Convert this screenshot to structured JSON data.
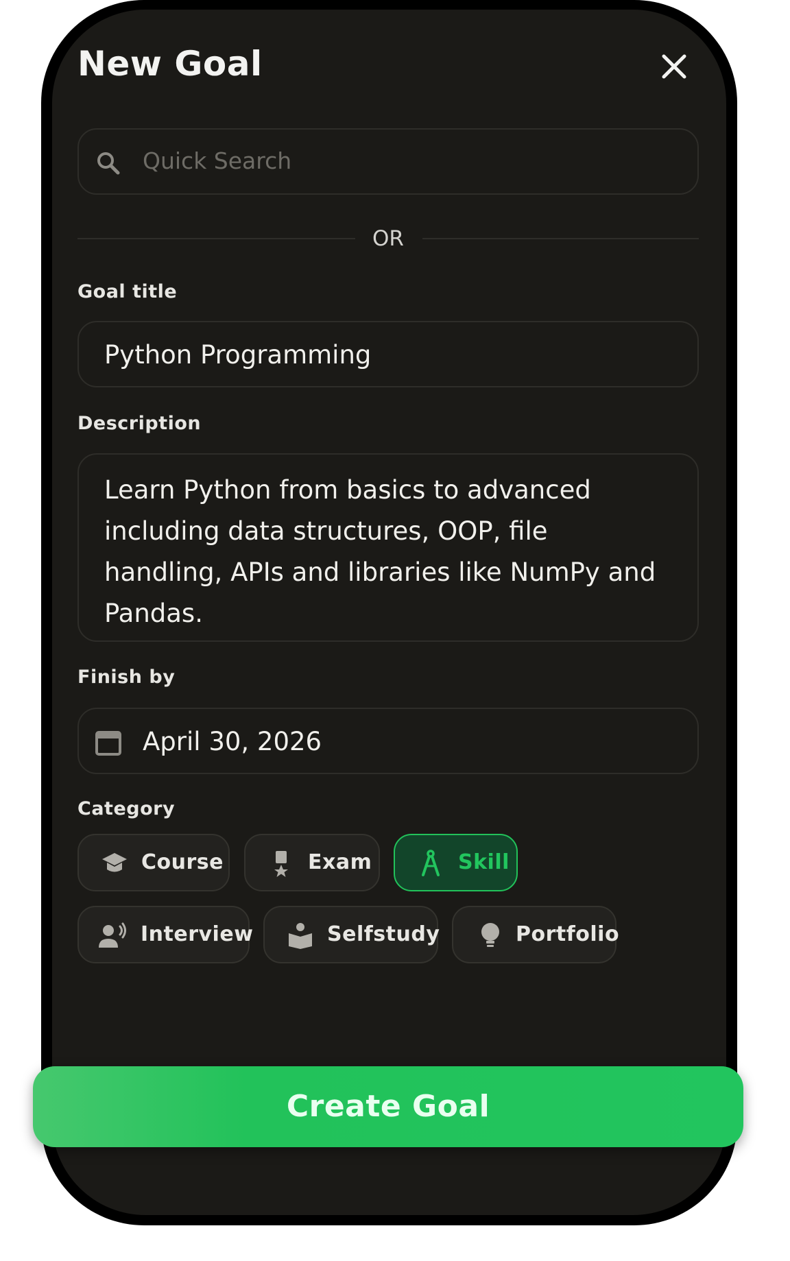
{
  "modal": {
    "title": "New Goal"
  },
  "search": {
    "placeholder": "Quick Search"
  },
  "divider": {
    "text": "OR"
  },
  "form": {
    "goal_title_label": "Goal title",
    "goal_title_value": "Python Programming",
    "description_label": "Description",
    "description_value": "Learn Python from basics to advanced including data structures, OOP, file handling, APIs and libraries like NumPy and Pandas.",
    "finish_label": "Finish by",
    "finish_value": "April 30, 2026",
    "category_label": "Category"
  },
  "categories": [
    {
      "label": "Course",
      "icon": "graduation-cap-icon",
      "selected": false
    },
    {
      "label": "Exam",
      "icon": "medal-icon",
      "selected": false
    },
    {
      "label": "Skill",
      "icon": "compass-icon",
      "selected": true
    },
    {
      "label": "Interview",
      "icon": "speaking-person-icon",
      "selected": false
    },
    {
      "label": "Selfstudy",
      "icon": "reading-person-icon",
      "selected": false
    },
    {
      "label": "Portfolio",
      "icon": "lightbulb-icon",
      "selected": false
    }
  ],
  "actions": {
    "create_label": "Create Goal"
  },
  "colors": {
    "accent": "#22c55e",
    "background": "#1b1a17",
    "selected_chip_bg": "#12452a"
  }
}
